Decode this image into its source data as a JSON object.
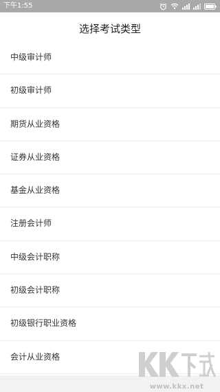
{
  "status_bar": {
    "time": "下午1:55",
    "icons": [
      "alarm-icon",
      "wifi-icon",
      "signal-icon",
      "signal-icon",
      "battery-icon"
    ]
  },
  "header": {
    "title": "选择考试类型"
  },
  "exam_types": [
    {
      "label": "中级审计师"
    },
    {
      "label": "初级审计师"
    },
    {
      "label": "期货从业资格"
    },
    {
      "label": "证券从业资格"
    },
    {
      "label": "基金从业资格"
    },
    {
      "label": "注册会计师"
    },
    {
      "label": "中级会计职称"
    },
    {
      "label": "初级会计职称"
    },
    {
      "label": "初级银行职业资格"
    },
    {
      "label": "会计从业资格"
    }
  ],
  "watermark": {
    "brand": "KK下载",
    "url": "www.kkx.net"
  },
  "colors": {
    "status_bar": "#a9a9a9",
    "background": "#ffffff",
    "divider": "#ececec",
    "watermark": "#bfbfbf"
  }
}
